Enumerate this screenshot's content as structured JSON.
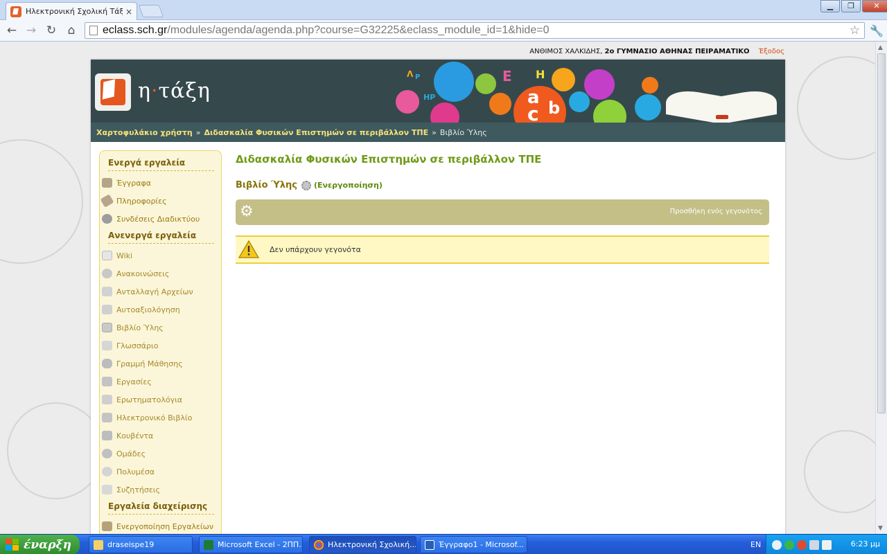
{
  "browser": {
    "tab_title": "Ηλεκτρονική Σχολική Τάξη (ε",
    "tab_close": "×",
    "url_host": "eclass.sch.gr",
    "url_path": "/modules/agenda/agenda.php?course=G32225&eclass_module_id=1&hide=0",
    "window_controls": {
      "minimize": "▁",
      "maximize": "❐",
      "close": "✕"
    },
    "nav": {
      "back": "←",
      "forward": "→",
      "reload": "↻",
      "home": "⌂",
      "star": "☆",
      "wrench": "🔧"
    }
  },
  "site": {
    "user_name": "ΑΝΘΙΜΟΣ ΧΑΛΚΙΔΗΣ,",
    "school": "2ο ΓΥΜΝΑΣΙΟ ΑΘΗΝΑΣ ΠΕΙΡΑΜΑΤΙΚΟ",
    "logout": "Έξοδος",
    "logo_text_1": "η",
    "logo_text_dot": "·",
    "logo_text_2": "τάξη",
    "breadcrumb": {
      "home": "Χαρτοφυλάκιο χρήστη",
      "course": "Διδασκαλία Φυσικών Επιστημών σε περιβάλλον ΤΠΕ",
      "current": "Βιβλίο Ύλης",
      "sep": "»"
    }
  },
  "sidebar": {
    "active_heading": "Ενεργά εργαλεία",
    "active_items": [
      {
        "label": "Έγγραφα",
        "icon": "folder-icon"
      },
      {
        "label": "Πληροφορίες",
        "icon": "tag-icon"
      },
      {
        "label": "Συνδέσεις Διαδικτύου",
        "icon": "link-icon"
      }
    ],
    "inactive_heading": "Ανενεργά εργαλεία",
    "inactive_items": [
      {
        "label": "Wiki",
        "icon": "wiki-icon"
      },
      {
        "label": "Ανακοινώσεις",
        "icon": "clock-icon"
      },
      {
        "label": "Ανταλλαγή Αρχείων",
        "icon": "files-icon"
      },
      {
        "label": "Αυτοαξιολόγηση",
        "icon": "self-eval-icon"
      },
      {
        "label": "Βιβλίο Ύλης",
        "icon": "calendar-icon"
      },
      {
        "label": "Γλωσσάριο",
        "icon": "glossary-icon"
      },
      {
        "label": "Γραμμή Μάθησης",
        "icon": "footsteps-icon"
      },
      {
        "label": "Εργασίες",
        "icon": "book-icon"
      },
      {
        "label": "Ερωτηματολόγια",
        "icon": "questionnaire-icon"
      },
      {
        "label": "Ηλεκτρονικό Βιβλίο",
        "icon": "ebook-icon"
      },
      {
        "label": "Κουβέντα",
        "icon": "chat-icon"
      },
      {
        "label": "Ομάδες",
        "icon": "groups-icon"
      },
      {
        "label": "Πολυμέσα",
        "icon": "multimedia-icon"
      },
      {
        "label": "Συζητήσεις",
        "icon": "forum-icon"
      }
    ],
    "admin_heading": "Εργαλεία διαχείρισης",
    "admin_items": [
      {
        "label": "Ενεργοποίηση Εργαλείων",
        "icon": "tools-icon"
      }
    ]
  },
  "main": {
    "course_title": "Διδασκαλία Φυσικών Επιστημών σε περιβάλλον ΤΠΕ",
    "module_title": "Βιβλίο Ύλης",
    "activate_link": "(Ενεργοποίηση)",
    "add_event": "Προσθήκη ενός γεγονότος",
    "empty_message": "Δεν υπάρχουν γεγονότα"
  },
  "taskbar": {
    "start_label": "έναρξη",
    "tasks": [
      {
        "label": "draseispe19",
        "icon": "folder-icon"
      },
      {
        "label": "Microsoft Excel - 2ΠΠ...",
        "icon": "excel-icon"
      },
      {
        "label": "Ηλεκτρονική Σχολική...",
        "icon": "chrome-icon"
      },
      {
        "label": "Έγγραφο1 - Microsof...",
        "icon": "word-icon"
      }
    ],
    "language": "EN",
    "clock": "6:23 μμ"
  }
}
